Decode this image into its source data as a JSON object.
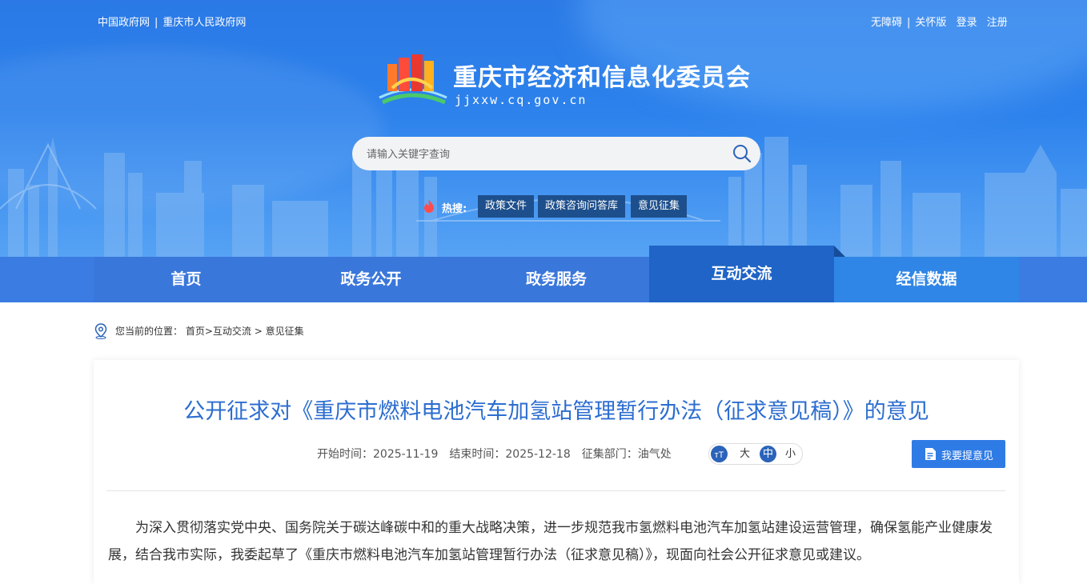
{
  "top_links": {
    "left": [
      "中国政府网",
      "重庆市人民政府网"
    ],
    "right": [
      "无障碍",
      "关怀版",
      "登录",
      "注册"
    ]
  },
  "site": {
    "title": "重庆市经济和信息化委员会",
    "domain": "jjxxw.cq.gov.cn"
  },
  "search": {
    "placeholder": "请输入关键字查询"
  },
  "hot_search": {
    "label": "热搜:",
    "tags": [
      "政策文件",
      "政策咨询问答库",
      "意见征集"
    ]
  },
  "nav": {
    "items": [
      "首页",
      "政务公开",
      "政务服务",
      "互动交流",
      "经信数据"
    ],
    "active": "互动交流"
  },
  "breadcrumb": {
    "prefix": "您当前的位置：",
    "items": [
      "首页",
      "互动交流",
      "意见征集"
    ]
  },
  "article": {
    "title": "公开征求对《重庆市燃料电池汽车加氢站管理暂行办法（征求意见稿）》的意见",
    "start": "开始时间：2025-11-19",
    "end": "结束时间：2025-12-18",
    "dept": "征集部门：油气处",
    "font_sizes": [
      "大",
      "中",
      "小"
    ],
    "font_selected": "中",
    "suggest_button": "我要提意见",
    "body": "为深入贯彻落实党中央、国务院关于碳达峰碳中和的重大战略决策，进一步规范我市氢燃料电池汽车加氢站建设运营管理，确保氢能产业健康发展，结合我市实际，我委起草了《重庆市燃料电池汽车加氢站管理暂行办法（征求意见稿）》，现面向社会公开征求意见或建议。"
  },
  "colors": {
    "banner_blue": "#2d82ec",
    "nav_blue": "#3b7ce3",
    "nav_active": "#1f64c6",
    "title_blue": "#2c6dd0",
    "tag_bg": "#1d4f8c",
    "button_blue": "#2f7be5"
  }
}
